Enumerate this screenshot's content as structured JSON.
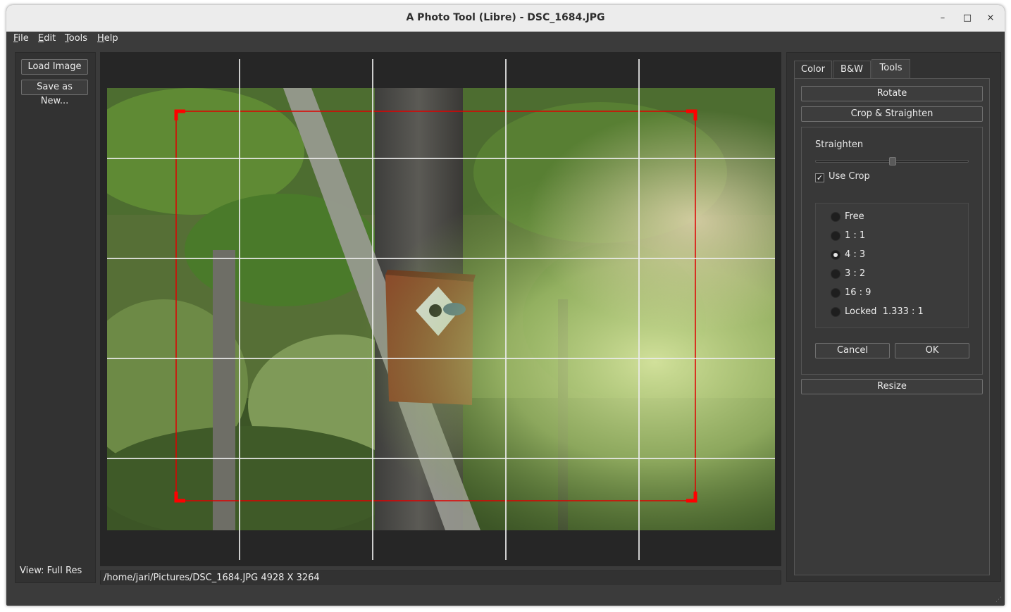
{
  "window": {
    "title": "A Photo Tool (Libre) - DSC_1684.JPG"
  },
  "window_controls": {
    "minimize": "–",
    "maximize": "□",
    "close": "×"
  },
  "menu": [
    {
      "mnemonic": "F",
      "rest": "ile"
    },
    {
      "mnemonic": "E",
      "rest": "dit"
    },
    {
      "mnemonic": "T",
      "rest": "ools"
    },
    {
      "mnemonic": "H",
      "rest": "elp"
    }
  ],
  "left_panel": {
    "load_image": "Load Image",
    "save_as_new": "Save as New...",
    "view_label": "View: Full Res"
  },
  "status": {
    "file_info": "/home/jari/Pictures/DSC_1684.JPG 4928 X 3264"
  },
  "tabs": [
    {
      "label": "Color",
      "active": false
    },
    {
      "label": "B&W",
      "active": false
    },
    {
      "label": "Tools",
      "active": true
    }
  ],
  "tools": {
    "rotate": "Rotate",
    "crop_straighten": "Crop & Straighten",
    "straighten_label": "Straighten",
    "straighten_value": 0.5,
    "use_crop_label": "Use Crop",
    "use_crop_checked": true,
    "aspect_options": [
      {
        "label": "Free",
        "checked": false
      },
      {
        "label": "1 : 1",
        "checked": false
      },
      {
        "label": "4 : 3",
        "checked": true
      },
      {
        "label": "3 : 2",
        "checked": false
      },
      {
        "label": "16 : 9",
        "checked": false
      },
      {
        "label": "Locked  1.333 : 1",
        "checked": false
      }
    ],
    "cancel": "Cancel",
    "ok": "OK",
    "resize": "Resize"
  },
  "colors": {
    "crop_frame": "#e00000",
    "panel_bg": "#323232",
    "canvas_bg": "#262626"
  }
}
